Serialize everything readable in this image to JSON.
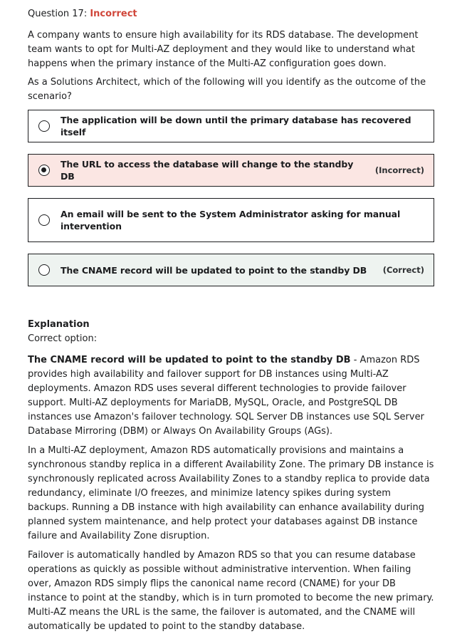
{
  "question": {
    "number_label": "Question 17:",
    "status": "Incorrect",
    "paragraph_1": "A company wants to ensure high availability for its RDS database. The development team wants to opt for Multi-AZ deployment and they would like to understand what happens when the primary instance of the Multi-AZ configuration goes down.",
    "paragraph_2": "As a Solutions Architect, which of the following will you identify as the outcome of the scenario?"
  },
  "options": [
    {
      "label": "The application will be down until the primary database has recovered itself",
      "selected": false,
      "tag": ""
    },
    {
      "label": "The URL to access the database will change to the standby DB",
      "selected": true,
      "tag": "(Incorrect)"
    },
    {
      "label": "An email will be sent to the System Administrator asking for manual intervention",
      "selected": false,
      "tag": ""
    },
    {
      "label": "The CNAME record will be updated to point to the standby DB",
      "selected": false,
      "tag": "(Correct)"
    }
  ],
  "explanation": {
    "title": "Explanation",
    "subtitle": "Correct option:",
    "p1_bold": "The CNAME record will be updated to point to the standby DB",
    "p1_rest": " - Amazon RDS provides high availability and failover support for DB instances using Multi-AZ deployments. Amazon RDS uses several different technologies to provide failover support. Multi-AZ deployments for MariaDB, MySQL, Oracle, and PostgreSQL DB instances use Amazon's failover technology. SQL Server DB instances use SQL Server Database Mirroring (DBM) or Always On Availability Groups (AGs).",
    "p2": "In a Multi-AZ deployment, Amazon RDS automatically provisions and maintains a synchronous standby replica in a different Availability Zone. The primary DB instance is synchronously replicated across Availability Zones to a standby replica to provide data redundancy, eliminate I/O freezes, and minimize latency spikes during system backups. Running a DB instance with high availability can enhance availability during planned system maintenance, and help protect your databases against DB instance failure and Availability Zone disruption.",
    "p3": "Failover is automatically handled by Amazon RDS so that you can resume database operations as quickly as possible without administrative intervention. When failing over, Amazon RDS simply flips the canonical name record (CNAME) for your DB instance to point at the standby, which is in turn promoted to become the new primary. Multi-AZ means the URL is the same, the failover is automated, and the CNAME will automatically be updated to point to the standby database."
  },
  "colors": {
    "status_incorrect": "#d0463a",
    "incorrect_bg": "#fbe6e3",
    "correct_bg": "#eef3f0",
    "border": "#1c1d1f"
  }
}
